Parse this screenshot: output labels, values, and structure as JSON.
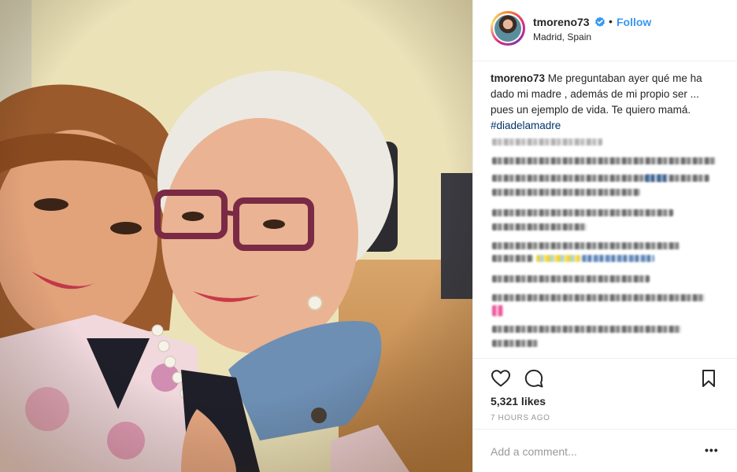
{
  "post": {
    "username": "tmoreno73",
    "separator": "•",
    "follow_label": "Follow",
    "location": "Madrid, Spain",
    "caption_username": "tmoreno73",
    "caption_text": "Me preguntaban ayer qué me ha dado mi madre , además de mi propio ser ... pues un ejemplo de vida. Te quiero mamá.",
    "hashtag": "#diadelamadre",
    "likes": "5,321 likes",
    "time_ago": "7 HOURS AGO",
    "comment_placeholder": "Add a comment...",
    "more_options": "•••"
  },
  "icons": {
    "verified": "verified-badge-icon",
    "like": "heart-icon",
    "comment": "comment-bubble-icon",
    "save": "bookmark-icon"
  },
  "colors": {
    "follow": "#3897f0",
    "hashtag": "#003569",
    "verified": "#3897f0",
    "muted": "#999999"
  }
}
